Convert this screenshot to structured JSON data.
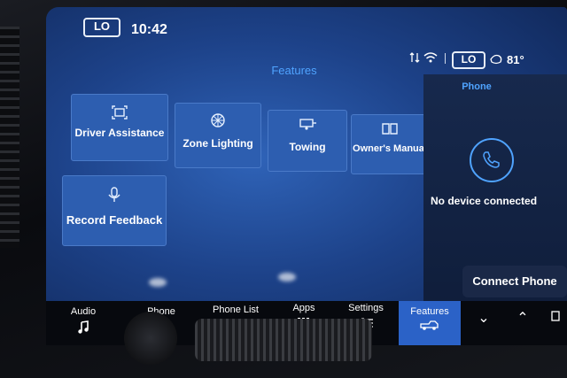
{
  "status_bar": {
    "climate_left": "LO",
    "time": "10:42",
    "climate_right": "LO",
    "temperature": "81°"
  },
  "features": {
    "title": "Features",
    "tiles": [
      {
        "label": "Driver Assistance",
        "icon": "driver-assistance-icon"
      },
      {
        "label": "Zone Lighting",
        "icon": "zone-lighting-icon"
      },
      {
        "label": "Towing",
        "icon": "towing-icon"
      },
      {
        "label": "Owner's Manual",
        "icon": "book-icon"
      },
      {
        "label": "Record Feedback",
        "icon": "microphone-icon"
      }
    ]
  },
  "phone_panel": {
    "title": "Phone",
    "status": "No device connected",
    "connect_label": "Connect Phone"
  },
  "dock": {
    "items": [
      {
        "label": "Audio",
        "icon": "music-note-icon"
      },
      {
        "label": "Phone",
        "icon": "phone-icon"
      },
      {
        "label": "Phone List",
        "icon": "phone-list-icon"
      },
      {
        "label": "Apps",
        "icon": "apps-grid-icon"
      },
      {
        "label": "Settings",
        "icon": "sliders-icon"
      },
      {
        "label": "Features",
        "icon": "truck-icon",
        "active": true
      }
    ]
  },
  "colors": {
    "screen_blue": "#2d5eb0",
    "accent": "#4fa3ff",
    "active_tab": "#2b62c7"
  }
}
